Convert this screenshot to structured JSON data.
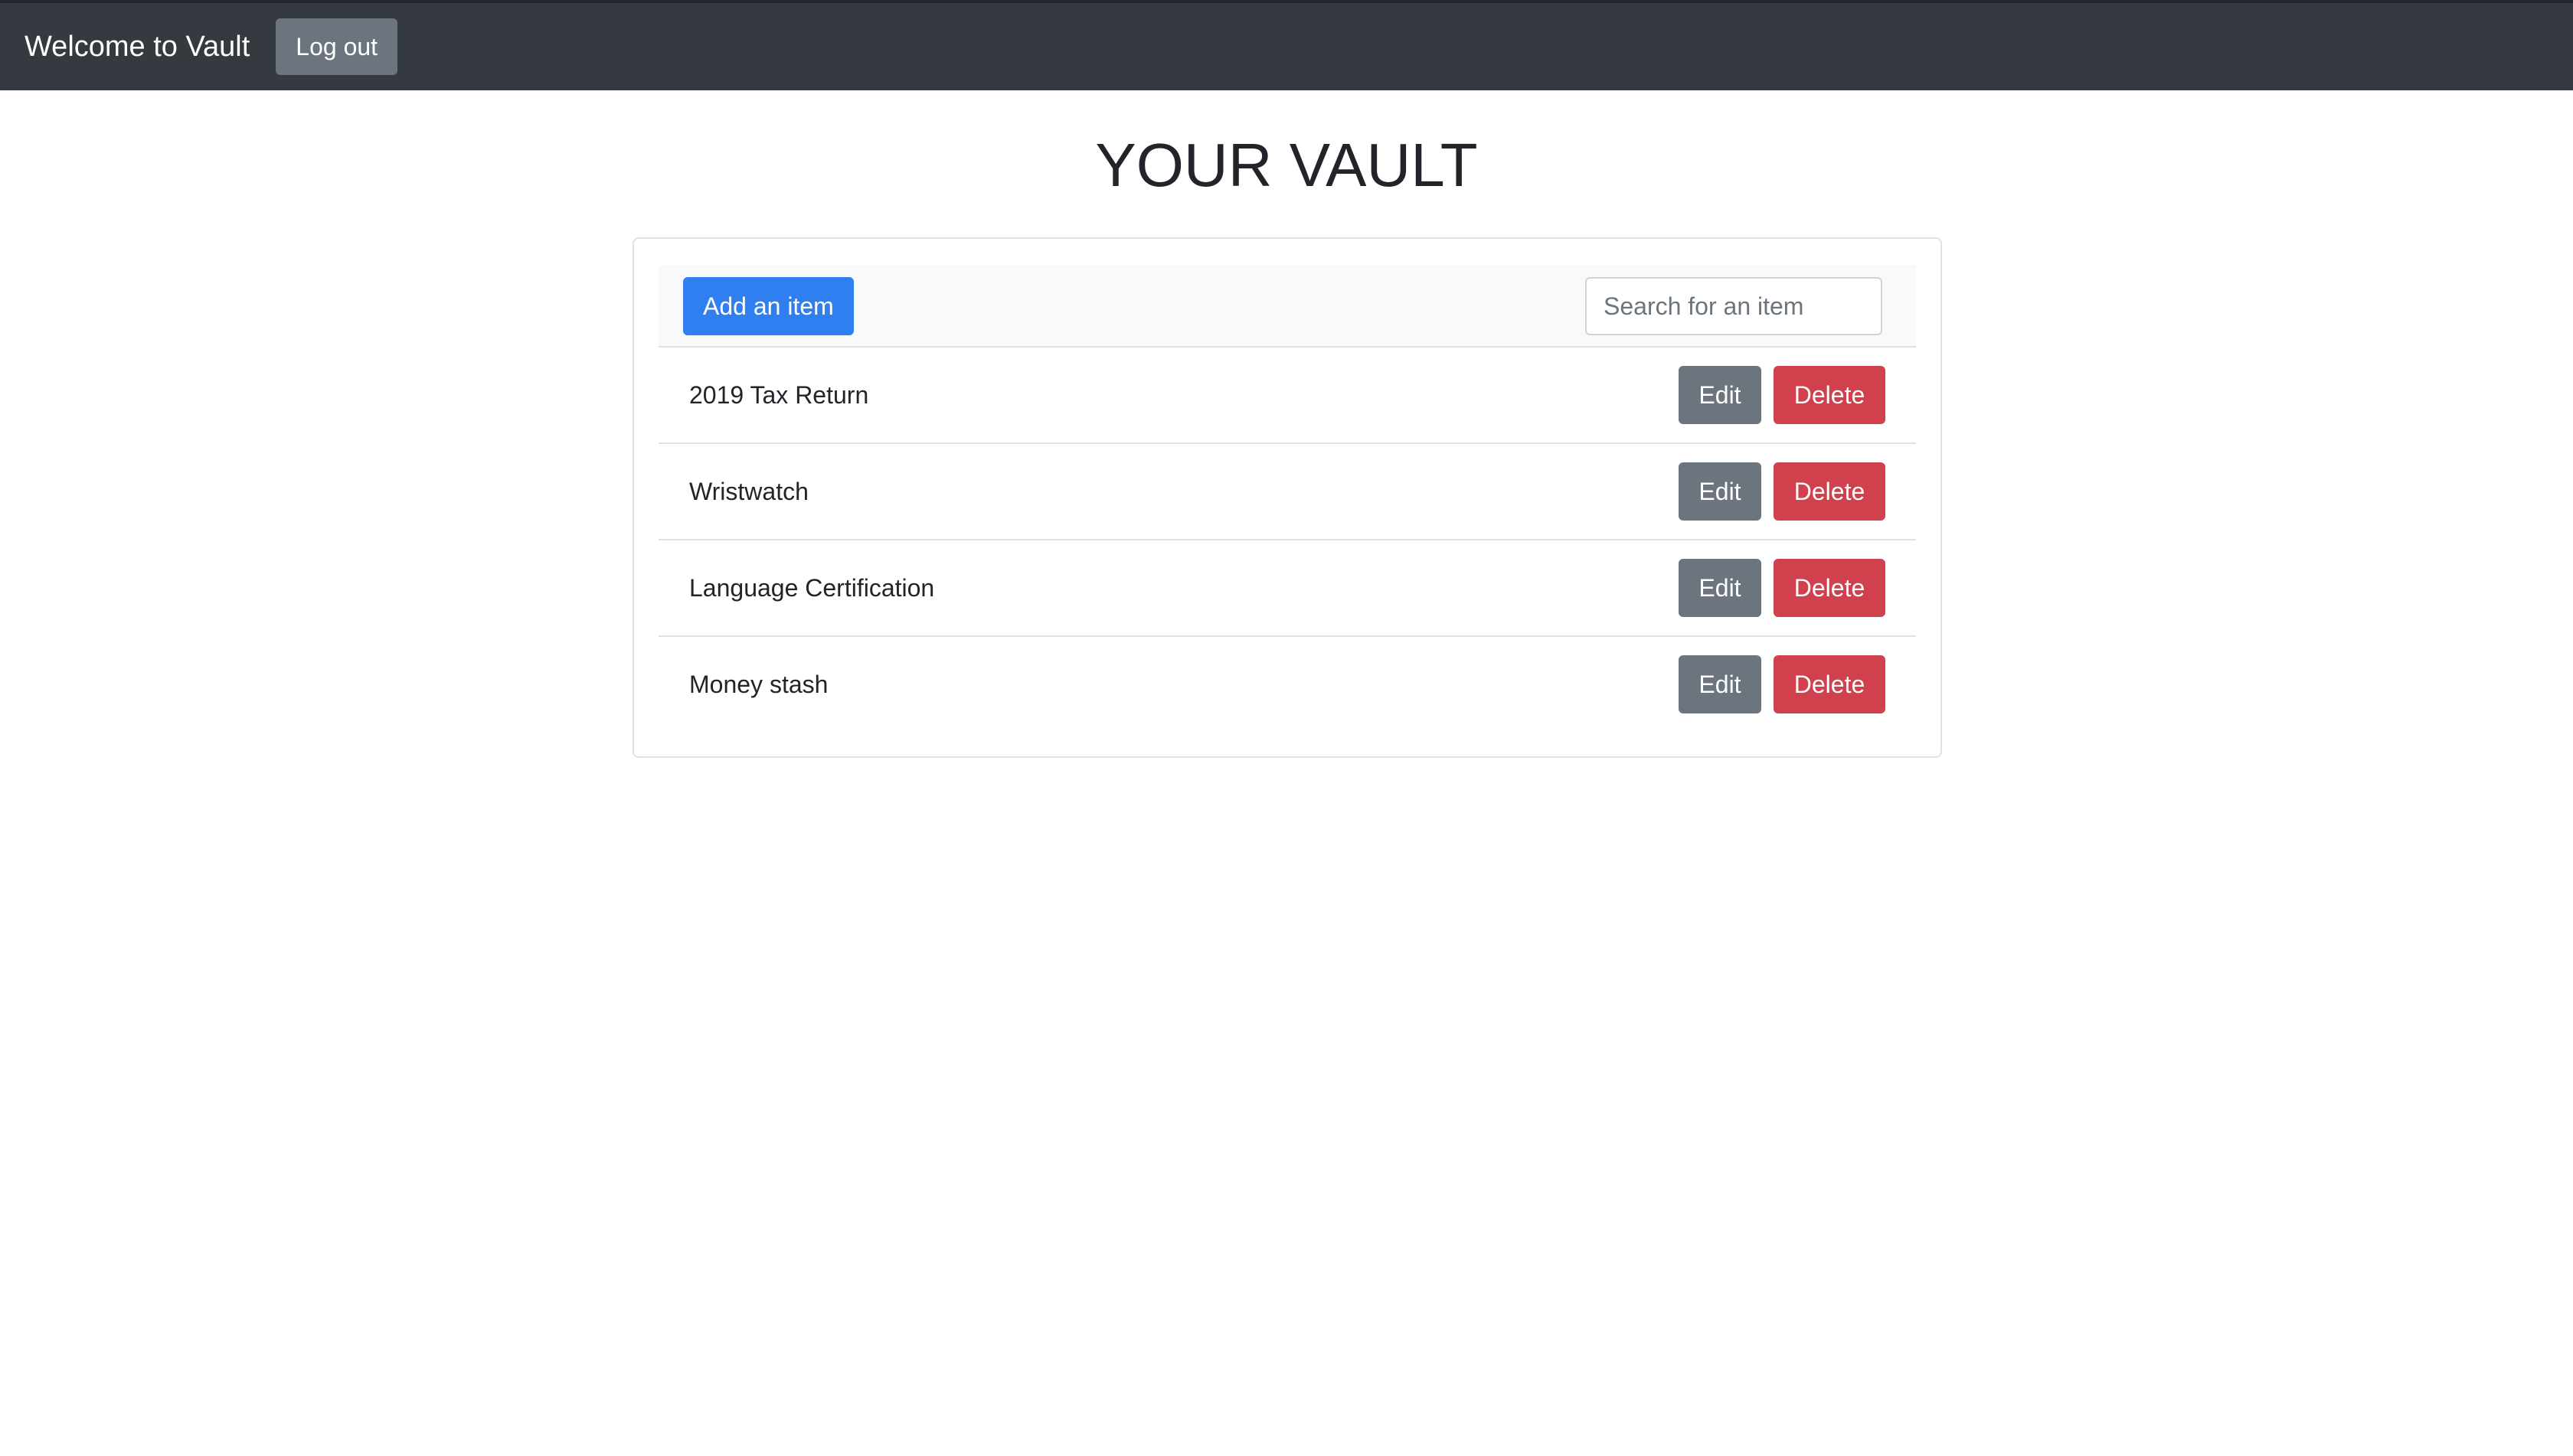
{
  "navbar": {
    "brand": "Welcome to Vault",
    "logout_label": "Log out"
  },
  "main": {
    "title": "YOUR VAULT",
    "toolbar": {
      "add_label": "Add an item",
      "search_placeholder": "Search for an item",
      "search_value": ""
    },
    "items": [
      {
        "label": "2019 Tax Return",
        "edit_label": "Edit",
        "delete_label": "Delete"
      },
      {
        "label": "Wristwatch",
        "edit_label": "Edit",
        "delete_label": "Delete"
      },
      {
        "label": "Language Certification",
        "edit_label": "Edit",
        "delete_label": "Delete"
      },
      {
        "label": "Money stash",
        "edit_label": "Edit",
        "delete_label": "Delete"
      }
    ]
  },
  "colors": {
    "navbar_bg": "#343a40",
    "primary": "#2f7ff0",
    "secondary": "#6c757d",
    "danger": "#d0404d"
  }
}
